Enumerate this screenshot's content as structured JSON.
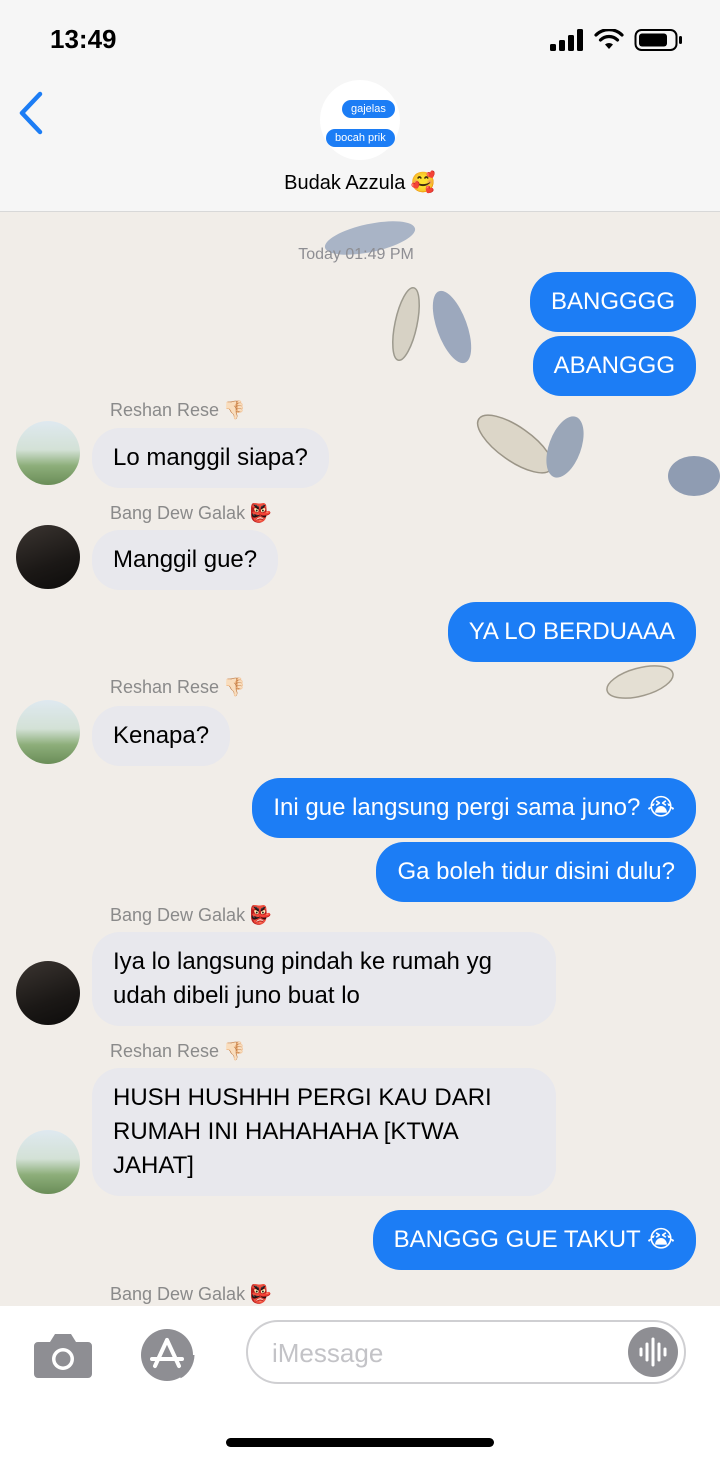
{
  "status": {
    "time": "13:49"
  },
  "header": {
    "group_name": "Budak Azzula",
    "group_emoji": "🥰",
    "avatar_bubbles": [
      "gajelas",
      "bocah prik"
    ]
  },
  "chat": {
    "timestamp": "Today 01:49 PM",
    "senders": {
      "reshan": {
        "name": "Reshan Rese",
        "emoji": "👎🏻"
      },
      "dew": {
        "name": "Bang Dew Galak",
        "emoji": "👺"
      }
    },
    "messages": [
      {
        "text": "BANGGGG"
      },
      {
        "text": "ABANGGG"
      },
      {
        "text": "Lo manggil siapa?"
      },
      {
        "text": "Manggil gue?"
      },
      {
        "text": "YA LO BERDUAAA"
      },
      {
        "text": "Kenapa?"
      },
      {
        "text": "Ini gue langsung pergi sama juno? 😭"
      },
      {
        "text": "Ga boleh tidur disini dulu?"
      },
      {
        "text": "Iya lo langsung pindah ke rumah yg udah dibeli juno buat lo"
      },
      {
        "text": "HUSH HUSHHH PERGI KAU DARI RUMAH INI HAHAHAHA [KTWA JAHAT]"
      },
      {
        "text": "BANGGG GUE TAKUT 😭"
      }
    ]
  },
  "input": {
    "placeholder": "iMessage"
  },
  "colors": {
    "accent": "#1c7df5",
    "incoming": "#e8e8ed",
    "wallpaper": "#f1ede8"
  },
  "icons": [
    "back-chevron-icon",
    "camera-icon",
    "app-store-icon",
    "audio-waveform-icon",
    "signal-icon",
    "wifi-icon",
    "battery-icon"
  ]
}
